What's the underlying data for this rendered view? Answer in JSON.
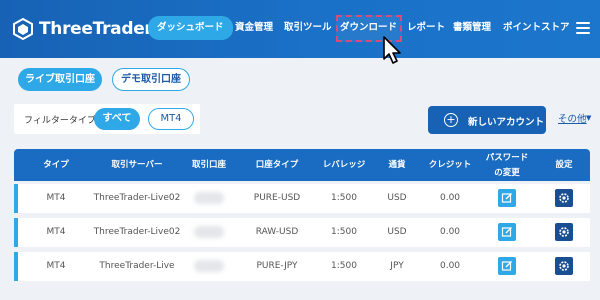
{
  "header": {
    "logo_text": "ThreeTrader",
    "nav": [
      {
        "label": "ダッシュボード",
        "active": true
      },
      {
        "label": "資金管理",
        "active": false
      },
      {
        "label": "取引ツール",
        "active": false
      },
      {
        "label": "ダウンロード",
        "active": false,
        "highlighted": true
      },
      {
        "label": "レポート",
        "active": false
      },
      {
        "label": "書類管理",
        "active": false
      },
      {
        "label": "ポイントストア",
        "active": false
      }
    ]
  },
  "account_tabs": {
    "live": "ライブ取引口座",
    "demo": "デモ取引口座"
  },
  "filter": {
    "label": "フィルタータイプ:",
    "all": "すべて",
    "mt4": "MT4"
  },
  "actions": {
    "new_account": "新しいアカウント",
    "other": "その他"
  },
  "table": {
    "headers": {
      "type": "タイプ",
      "server": "取引サーバー",
      "account": "取引口座",
      "account_type": "口座タイプ",
      "leverage": "レバレッジ",
      "currency": "通貨",
      "credit": "クレジット",
      "password_line1": "パスワード",
      "password_line2": "の変更",
      "settings": "設定"
    },
    "rows": [
      {
        "type": "MT4",
        "server": "ThreeTrader-Live02",
        "account_type": "PURE-USD",
        "leverage": "1:500",
        "currency": "USD",
        "credit": "0.00"
      },
      {
        "type": "MT4",
        "server": "ThreeTrader-Live02",
        "account_type": "RAW-USD",
        "leverage": "1:500",
        "currency": "USD",
        "credit": "0.00"
      },
      {
        "type": "MT4",
        "server": "ThreeTrader-Live",
        "account_type": "PURE-JPY",
        "leverage": "1:500",
        "currency": "JPY",
        "credit": "0.00"
      }
    ]
  },
  "colors": {
    "header_blue": "#1762b5",
    "accent_cyan": "#2fa8e8",
    "table_head": "#1a6cc2",
    "settings_navy": "#1a4e92"
  }
}
